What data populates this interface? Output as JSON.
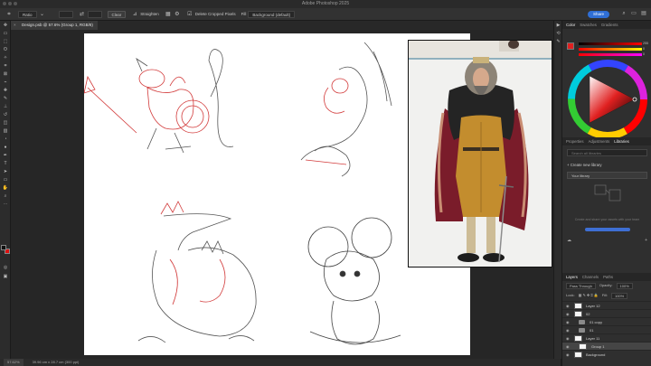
{
  "window": {
    "title": "Adobe Photoshop 2025"
  },
  "options_bar": {
    "ratio_label": "Ratio",
    "clear_label": "Clear",
    "straighten_label": "Straighten",
    "delete_cropped_label": "Delete Cropped Pixels",
    "fill_label": "Fill",
    "fill_value": "Background (default)",
    "share_label": "Share"
  },
  "document": {
    "tab_title": "Design.psb @ 57.6% (Group 1, RGB/8)"
  },
  "status_bar": {
    "zoom": "57.62%",
    "size": "39.96 cm x 28.7 cm (300 ppi)"
  },
  "color_panel": {
    "tabs": [
      "Color",
      "Swatches",
      "Gradients"
    ],
    "fg_color": "#e02020",
    "sliders": [
      {
        "label": "R",
        "value": "255"
      },
      {
        "label": "G",
        "value": "0"
      },
      {
        "label": "B",
        "value": "0"
      }
    ]
  },
  "library_panel": {
    "tabs": [
      "Properties",
      "Adjustments",
      "Libraries"
    ],
    "search_placeholder": "Search all libraries",
    "create_label": "Create new library",
    "library_name": "Your library",
    "empty_text": "Create and share your assets with your team"
  },
  "layers_panel": {
    "tabs": [
      "Layers",
      "Channels",
      "Paths"
    ],
    "blend_mode": "Pass Through",
    "opacity_label": "Opacity:",
    "opacity_value": "100%",
    "lock_label": "Lock:",
    "fill_label": "Fill:",
    "fill_value": "100%",
    "layers": [
      {
        "name": "Layer 12",
        "kind": "layer"
      },
      {
        "name": "02",
        "kind": "folder"
      },
      {
        "name": "01 copy",
        "kind": "folder"
      },
      {
        "name": "01",
        "kind": "folder"
      },
      {
        "name": "Layer 11",
        "kind": "layer"
      },
      {
        "name": "Group 1",
        "kind": "group",
        "selected": true
      },
      {
        "name": "Background",
        "kind": "layer"
      }
    ]
  }
}
